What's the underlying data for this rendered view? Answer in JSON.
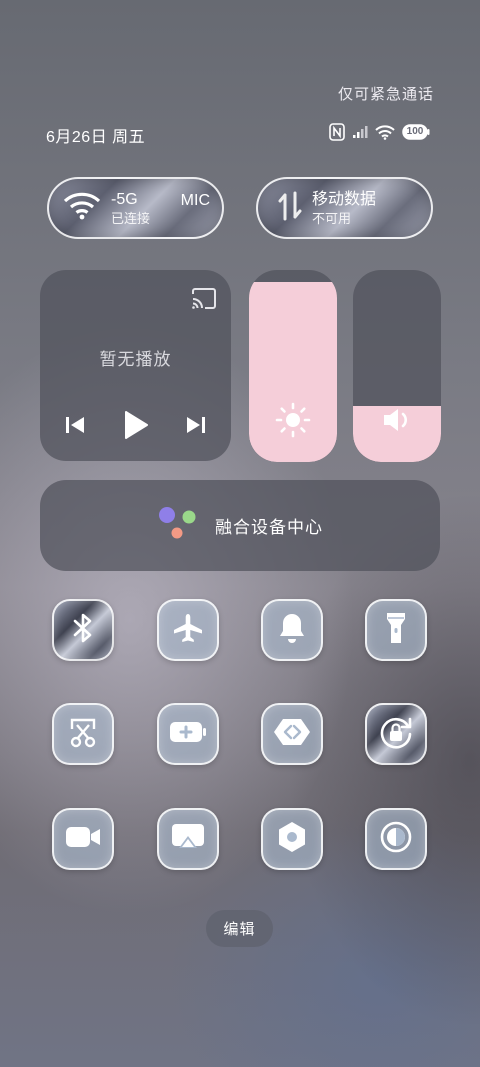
{
  "status_bar": {
    "emergency_text": "仅可紧急通话",
    "date_text": "6月26日 周五",
    "battery_level": "100",
    "icons": [
      "nfc-icon",
      "signal-icon",
      "wifi-icon",
      "battery-icon"
    ]
  },
  "wifi_pill": {
    "ssid_fragment": "-5G",
    "ssid_fragment_right": "MIC",
    "status": "已连接"
  },
  "data_pill": {
    "title": "移动数据",
    "status": "不可用"
  },
  "media": {
    "status": "暂无播放"
  },
  "sliders": {
    "brightness_level": 0.94,
    "volume_level": 0.29
  },
  "device_center": {
    "label": "融合设备中心"
  },
  "tiles": [
    "bluetooth-icon",
    "airplane-icon",
    "bell-icon",
    "flashlight-icon",
    "screenshot-icon",
    "battery-saver-icon",
    "share-icon",
    "rotation-lock-icon",
    "screen-record-icon",
    "screen-cast-icon",
    "settings-icon",
    "dark-mode-icon"
  ],
  "edit_button": {
    "label": "编辑"
  },
  "colors": {
    "accent_pink": "#f5ced9",
    "tile_bg": "#aab9cd",
    "card_bg": "#50525c"
  }
}
